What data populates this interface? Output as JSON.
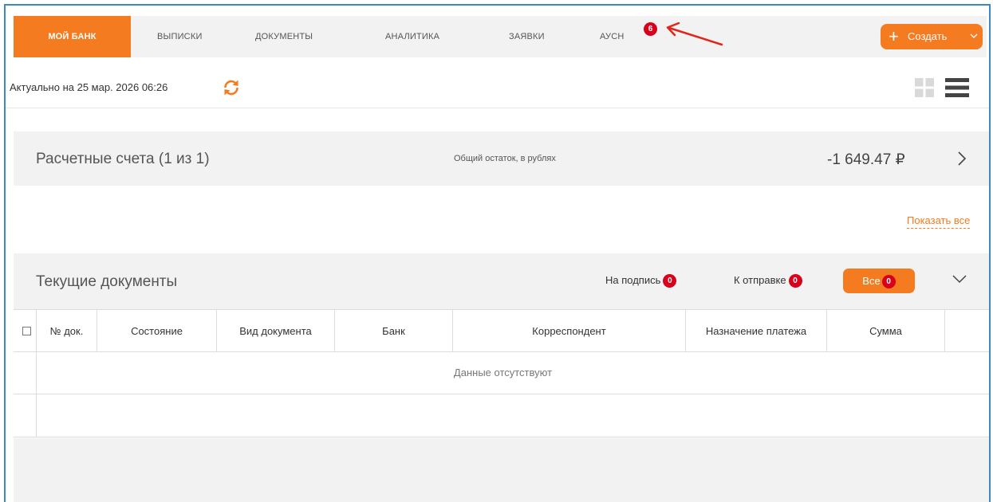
{
  "nav": {
    "tabs": [
      {
        "label": "МОЙ БАНК",
        "active": true
      },
      {
        "label": "ВЫПИСКИ",
        "active": false
      },
      {
        "label": "ДОКУМЕНТЫ",
        "active": false
      },
      {
        "label": "АНАЛИТИКА",
        "active": false
      },
      {
        "label": "ЗАЯВКИ",
        "active": false
      },
      {
        "label": "АУСН",
        "active": false
      }
    ],
    "ausn_badge": "6",
    "create_label": "Создать",
    "create_icon": "plus-icon",
    "annotation_icon": "red-arrow-icon"
  },
  "status": {
    "updated_text": "Актуально на 25 мар. 2026 06:26",
    "refresh_icon": "refresh-icon",
    "view_icons": [
      "grid-view-icon",
      "list-view-icon"
    ]
  },
  "accounts": {
    "title": "Расчетные счета (1 из 1)",
    "balance_caption": "Общий остаток, в рублях",
    "balance_total": "-1 649.47 ₽",
    "show_all": "Показать все"
  },
  "documents": {
    "title": "Текущие документы",
    "filters": [
      {
        "label": "На подпись",
        "count": "0"
      },
      {
        "label": "К отправке",
        "count": "0"
      },
      {
        "label": "Все",
        "count": "0",
        "active": true
      }
    ],
    "table": {
      "columns": [
        "№ док.",
        "Состояние",
        "Вид документа",
        "Банк",
        "Корреспондент",
        "Назначение платежа",
        "Сумма"
      ],
      "empty_message": "Данные отсутствуют"
    }
  },
  "colors": {
    "accent": "#f47b20",
    "badge": "#d9001b",
    "panel_bg": "#f2f2f2",
    "frame_border": "#3b87c8"
  }
}
